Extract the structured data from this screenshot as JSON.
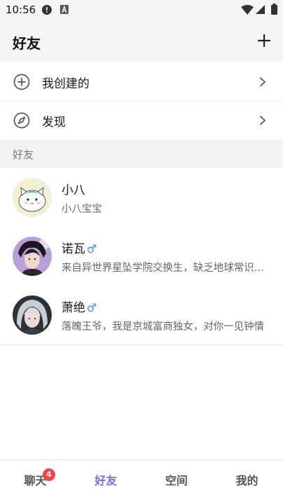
{
  "status_bar": {
    "time": "10:56",
    "icons": [
      "alert-icon",
      "a-icon",
      "wifi-icon",
      "signal-icon",
      "battery-icon"
    ]
  },
  "header": {
    "title": "好友",
    "add_icon": "plus-icon"
  },
  "menu": [
    {
      "label": "我创建的",
      "icon": "plus-circle-icon"
    },
    {
      "label": "发现",
      "icon": "compass-icon"
    }
  ],
  "section": {
    "title": "好友"
  },
  "friends": [
    {
      "name": "小八",
      "gender": "",
      "desc": "小八宝宝"
    },
    {
      "name": "诺瓦",
      "gender": "♂",
      "desc": "来自异世界星坠学院交换生，缺乏地球常识，对一切都充满好奇"
    },
    {
      "name": "萧绝",
      "gender": "♂",
      "desc": "落魄王爷，我是京城富商独女，对你一见钟情"
    }
  ],
  "tabbar": {
    "tabs": [
      {
        "label": "聊天",
        "badge": "4"
      },
      {
        "label": "好友"
      },
      {
        "label": "空间"
      },
      {
        "label": "我的"
      }
    ],
    "active_index": 1
  },
  "colors": {
    "accent": "#6f6ef5",
    "badge": "#ee4444",
    "gender_male": "#3b8fe6"
  }
}
